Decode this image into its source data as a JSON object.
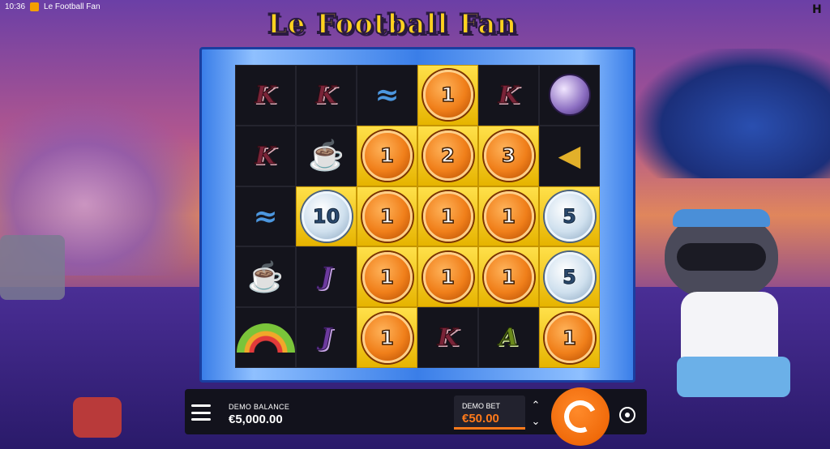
{
  "status": {
    "time": "10:36",
    "page_title": "Le Football Fan"
  },
  "game": {
    "title": "Le Football Fan"
  },
  "reels": {
    "rows": [
      [
        {
          "kind": "letter",
          "text": "K",
          "gold": false
        },
        {
          "kind": "letter",
          "text": "K",
          "gold": false
        },
        {
          "kind": "icon",
          "icon": "scarf-icon",
          "gold": false
        },
        {
          "kind": "coin",
          "text": "1",
          "tone": "orange",
          "gold": true
        },
        {
          "kind": "letter",
          "text": "K",
          "gold": false
        },
        {
          "kind": "icon",
          "icon": "ball-icon",
          "gold": false
        }
      ],
      [
        {
          "kind": "letter",
          "text": "K",
          "gold": false
        },
        {
          "kind": "icon",
          "icon": "beer-icon",
          "gold": false
        },
        {
          "kind": "coin",
          "text": "1",
          "tone": "orange",
          "gold": true
        },
        {
          "kind": "coin",
          "text": "2",
          "tone": "orange",
          "gold": true
        },
        {
          "kind": "coin",
          "text": "3",
          "tone": "orange",
          "gold": true
        },
        {
          "kind": "icon",
          "icon": "horn-icon",
          "gold": false
        }
      ],
      [
        {
          "kind": "icon",
          "icon": "scarf-icon",
          "gold": false
        },
        {
          "kind": "coin",
          "text": "10",
          "tone": "silver",
          "gold": true
        },
        {
          "kind": "coin",
          "text": "1",
          "tone": "orange",
          "gold": true
        },
        {
          "kind": "coin",
          "text": "1",
          "tone": "orange",
          "gold": true
        },
        {
          "kind": "coin",
          "text": "1",
          "tone": "orange",
          "gold": true
        },
        {
          "kind": "coin",
          "text": "5",
          "tone": "silver",
          "gold": true
        }
      ],
      [
        {
          "kind": "icon",
          "icon": "beer-icon",
          "gold": false
        },
        {
          "kind": "letter",
          "text": "J",
          "gold": false
        },
        {
          "kind": "coin",
          "text": "1",
          "tone": "orange",
          "gold": true
        },
        {
          "kind": "coin",
          "text": "1",
          "tone": "orange",
          "gold": true
        },
        {
          "kind": "coin",
          "text": "1",
          "tone": "orange",
          "gold": true
        },
        {
          "kind": "coin",
          "text": "5",
          "tone": "silver",
          "gold": true
        }
      ],
      [
        {
          "kind": "icon",
          "icon": "rainbow-icon",
          "gold": false
        },
        {
          "kind": "letter",
          "text": "J",
          "gold": false
        },
        {
          "kind": "coin",
          "text": "1",
          "tone": "orange",
          "gold": true
        },
        {
          "kind": "letter",
          "text": "K",
          "gold": false
        },
        {
          "kind": "letter",
          "text": "A",
          "gold": false
        },
        {
          "kind": "coin",
          "text": "1",
          "tone": "orange",
          "gold": true
        }
      ]
    ]
  },
  "hud": {
    "balance_label": "DEMO BALANCE",
    "balance_value": "€5,000.00",
    "bet_label": "DEMO BET",
    "bet_value": "€50.00",
    "accent_color": "#ff7a1a"
  }
}
